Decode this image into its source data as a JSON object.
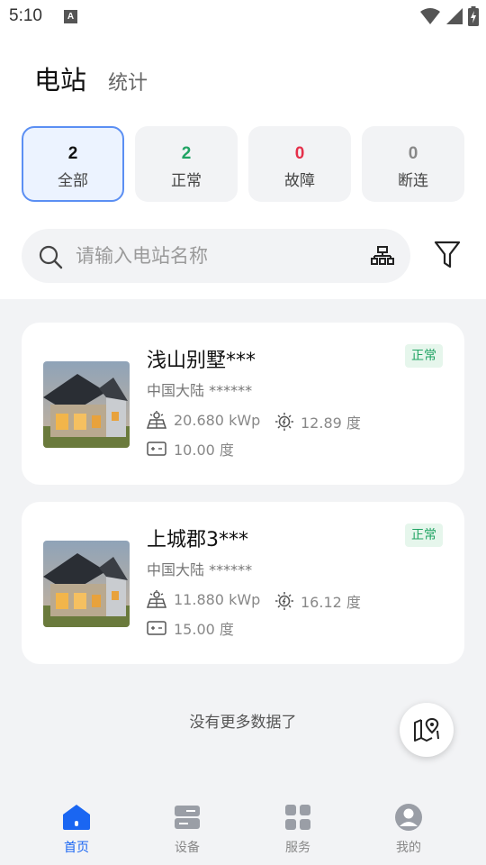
{
  "status_bar": {
    "time": "5:10",
    "notification_icon": "A"
  },
  "header": {
    "title": "电站",
    "secondary_tab": "统计"
  },
  "stats": [
    {
      "count": "2",
      "label": "全部",
      "color": "#111111",
      "active": true
    },
    {
      "count": "2",
      "label": "正常",
      "color": "#21a464",
      "active": false
    },
    {
      "count": "0",
      "label": "故障",
      "color": "#e5304a",
      "active": false
    },
    {
      "count": "0",
      "label": "断连",
      "color": "#888888",
      "active": false
    }
  ],
  "search": {
    "placeholder": "请输入电站名称",
    "value": ""
  },
  "stations": [
    {
      "name": "浅山别墅***",
      "region": "中国大陆 ******",
      "capacity": "20.680 kWp",
      "today_yield": "12.89 度",
      "total": "10.00 度",
      "status": "正常"
    },
    {
      "name": "上城郡3***",
      "region": "中国大陆 ******",
      "capacity": "11.880 kWp",
      "today_yield": "16.12 度",
      "total": "15.00 度",
      "status": "正常"
    }
  ],
  "list_footer": "没有更多数据了",
  "tabs": [
    {
      "label": "首页",
      "icon": "home-icon",
      "active": true
    },
    {
      "label": "设备",
      "icon": "device-icon",
      "active": false
    },
    {
      "label": "服务",
      "icon": "service-icon",
      "active": false
    },
    {
      "label": "我的",
      "icon": "profile-icon",
      "active": false
    }
  ],
  "colors": {
    "accent": "#1a66f2",
    "normal": "#21a464",
    "fault": "#e5304a",
    "background": "#f2f3f5"
  }
}
